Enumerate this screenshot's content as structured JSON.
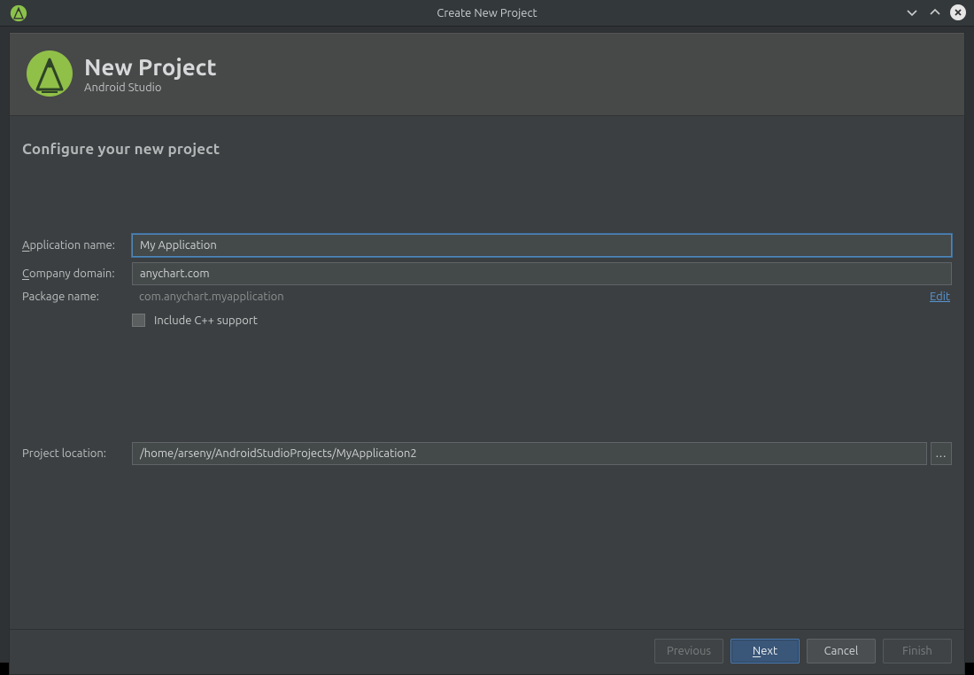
{
  "window": {
    "title": "Create New Project"
  },
  "header": {
    "title": "New Project",
    "subtitle": "Android Studio"
  },
  "section": {
    "title": "Configure your new project"
  },
  "form": {
    "app_name_label_pre": "A",
    "app_name_label_post": "pplication name:",
    "app_name_value": "My Application",
    "company_label_pre": "C",
    "company_label_post": "ompany domain:",
    "company_value": "anychart.com",
    "package_label": "Package name:",
    "package_value": "com.anychart.myapplication",
    "edit_link": "Edit",
    "cpp_label": "Include C++ support",
    "location_label": "Project location:",
    "location_value": "/home/arseny/AndroidStudioProjects/MyApplication2",
    "browse_label": "..."
  },
  "footer": {
    "previous": "Previous",
    "next_pre": "N",
    "next_post": "ext",
    "cancel": "Cancel",
    "finish": "Finish"
  }
}
